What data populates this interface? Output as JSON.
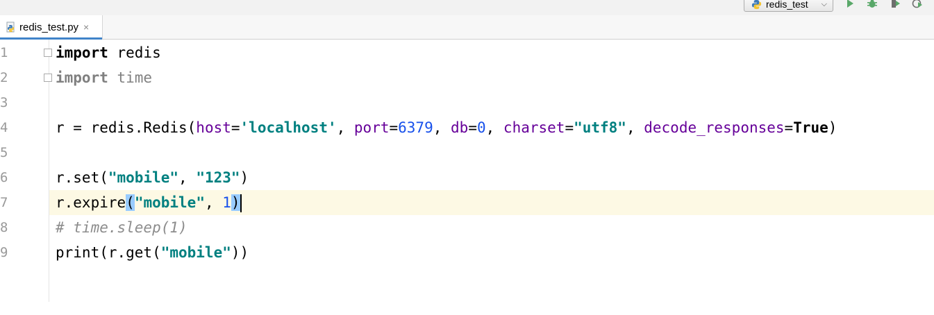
{
  "toolbar": {
    "run_config_label": "redis_test",
    "icons": [
      "python-icon",
      "run-icon",
      "debug-icon",
      "coverage-icon",
      "profile-icon"
    ]
  },
  "tab": {
    "file_name": "redis_test.py",
    "close_glyph": "×"
  },
  "line_numbers": [
    "1",
    "2",
    "3",
    "4",
    "5",
    "6",
    "7",
    "8",
    "9"
  ],
  "code": {
    "l1": {
      "kw": "import",
      "rest": " redis"
    },
    "l2": {
      "kw": "import",
      "rest": " time"
    },
    "l4": {
      "p1": "r = redis.Redis(",
      "host_kw": "host",
      "eq1": "=",
      "host_val": "'localhost'",
      "sep1": ", ",
      "port_kw": "port",
      "eq2": "=",
      "port_val": "6379",
      "sep2": ", ",
      "db_kw": "db",
      "eq3": "=",
      "db_val": "0",
      "sep3": ", ",
      "charset_kw": "charset",
      "eq4": "=",
      "charset_val": "\"utf8\"",
      "sep4": ", ",
      "decode_kw": "decode_responses",
      "eq5": "=",
      "decode_val": "True",
      "close": ")"
    },
    "l6": {
      "p1": "r.set(",
      "s1": "\"mobile\"",
      "sep": ", ",
      "s2": "\"123\"",
      "close": ")"
    },
    "l7": {
      "p1": "r.expire",
      "open": "(",
      "s1": "\"mobile\"",
      "sep": ", ",
      "n1": "1",
      "close": ")"
    },
    "l8": {
      "comment": "# time.sleep(1)"
    },
    "l9": {
      "p1": "print(r.get(",
      "s1": "\"mobile\"",
      "close": "))"
    }
  }
}
